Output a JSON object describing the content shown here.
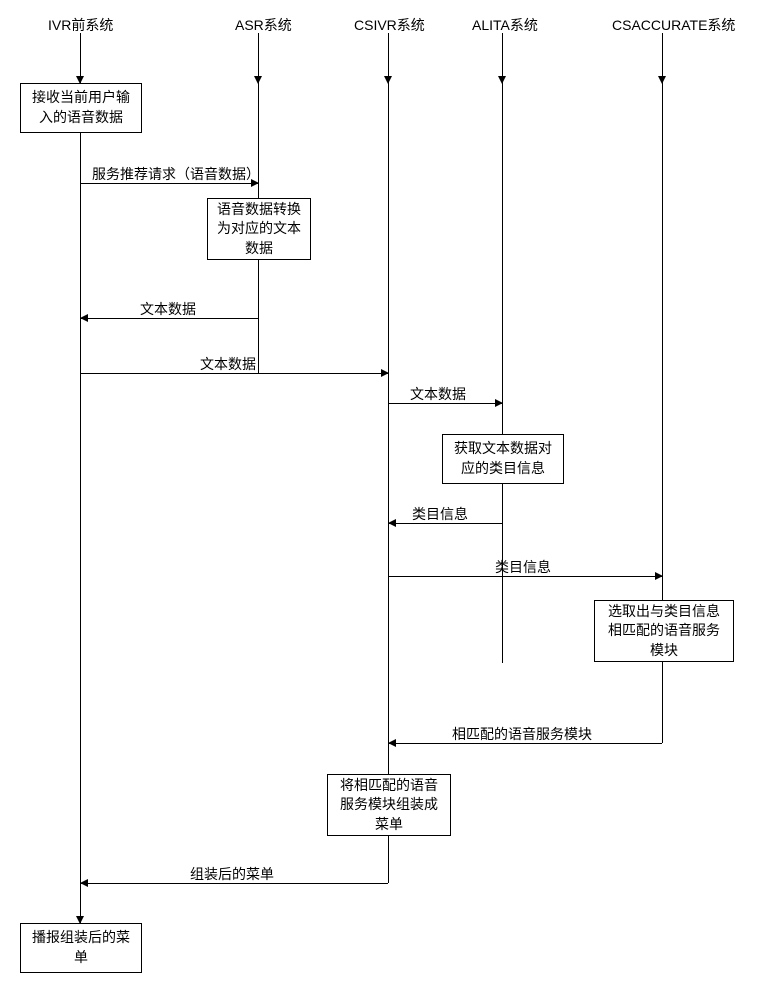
{
  "participants": {
    "ivr": "IVR前系统",
    "asr": "ASR系统",
    "csivr": "CSIVR系统",
    "alita": "ALITA系统",
    "csaccurate": "CSACCURATE系统"
  },
  "boxes": {
    "b1": "接收当前用户输\n入的语音数据",
    "b2": "语音数据转换\n为对应的文本\n数据",
    "b3": "获取文本数据对\n应的类目信息",
    "b4": "选取出与类目信息\n相匹配的语音服务\n模块",
    "b5": "将相匹配的语音\n服务模块组装成\n菜单",
    "b6": "播报组装后的菜\n单"
  },
  "messages": {
    "m1": "服务推荐请求（语音数据）",
    "m2": "文本数据",
    "m3": "文本数据",
    "m4": "文本数据",
    "m5": "类目信息",
    "m6": "类目信息",
    "m7": "相匹配的语音服务模块",
    "m8": "组装后的菜单"
  }
}
